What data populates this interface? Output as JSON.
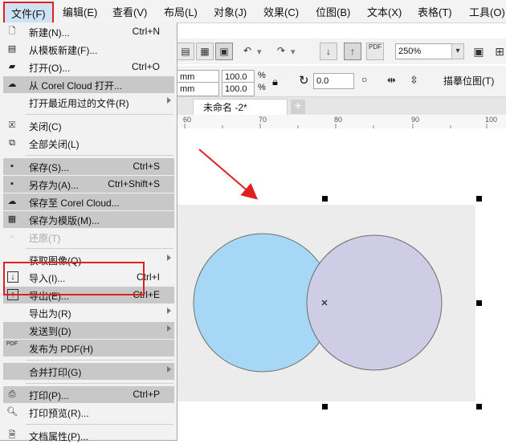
{
  "menubar": {
    "items": [
      {
        "id": "file",
        "label": "文件(F)"
      },
      {
        "id": "edit",
        "label": "编辑(E)"
      },
      {
        "id": "view",
        "label": "查看(V)"
      },
      {
        "id": "layout",
        "label": "布局(L)"
      },
      {
        "id": "object",
        "label": "对象(J)"
      },
      {
        "id": "effects",
        "label": "效果(C)"
      },
      {
        "id": "bitmap",
        "label": "位图(B)"
      },
      {
        "id": "text",
        "label": "文本(X)"
      },
      {
        "id": "table",
        "label": "表格(T)"
      },
      {
        "id": "tools",
        "label": "工具(O)"
      }
    ]
  },
  "file_menu": {
    "items": [
      {
        "label": "新建(N)...",
        "shortcut": "Ctrl+N",
        "icon": "new-document-icon"
      },
      {
        "label": "从模板新建(F)...",
        "shortcut": "",
        "icon": "new-from-template-icon"
      },
      {
        "label": "打开(O)...",
        "shortcut": "Ctrl+O",
        "icon": "open-folder-icon"
      },
      {
        "label": "从 Corel Cloud 打开...",
        "shortcut": "",
        "icon": "cloud-download-icon"
      },
      {
        "label": "打开最近用过的文件(R)",
        "shortcut": "",
        "icon": ""
      },
      {
        "label": "关闭(C)",
        "shortcut": "",
        "icon": "close-document-icon"
      },
      {
        "label": "全部关闭(L)",
        "shortcut": "",
        "icon": "close-all-icon"
      },
      {
        "label": "保存(S)...",
        "shortcut": "Ctrl+S",
        "icon": "save-icon"
      },
      {
        "label": "另存为(A)...",
        "shortcut": "Ctrl+Shift+S",
        "icon": "save-as-icon"
      },
      {
        "label": "保存至 Corel Cloud...",
        "shortcut": "",
        "icon": "cloud-upload-icon"
      },
      {
        "label": "保存为模版(M)...",
        "shortcut": "",
        "icon": "save-template-icon"
      },
      {
        "label": "还原(T)",
        "shortcut": "",
        "icon": "revert-icon"
      },
      {
        "label": "获取图像(Q)",
        "shortcut": "",
        "icon": ""
      },
      {
        "label": "导入(I)...",
        "shortcut": "Ctrl+I",
        "icon": "import-icon"
      },
      {
        "label": "导出(E)...",
        "shortcut": "Ctrl+E",
        "icon": "export-icon"
      },
      {
        "label": "导出为(R)",
        "shortcut": "",
        "icon": ""
      },
      {
        "label": "发送到(D)",
        "shortcut": "",
        "icon": ""
      },
      {
        "label": "发布为 PDF(H)",
        "shortcut": "",
        "icon": "pdf-icon"
      },
      {
        "label": "合并打印(G)",
        "shortcut": "",
        "icon": ""
      },
      {
        "label": "打印(P)...",
        "shortcut": "Ctrl+P",
        "icon": "print-icon"
      },
      {
        "label": "打印预览(R)...",
        "shortcut": "",
        "icon": "print-preview-icon"
      },
      {
        "label": "文档属性(P)...",
        "shortcut": "",
        "icon": "document-properties-icon"
      }
    ]
  },
  "toolbar": {
    "zoom_value": "250%",
    "pdf_label": "PDF",
    "unit1": "mm",
    "unit2": "mm",
    "scale_x": "100.0",
    "scale_y": "100.0",
    "percent1": "%",
    "percent2": "%",
    "rotation": "0.0",
    "trace_bitmap": "描摹位图(T)"
  },
  "document": {
    "tab_title": "未命名 -2*",
    "ruler_labels": [
      "60",
      "70",
      "80",
      "90",
      "100"
    ]
  },
  "colors": {
    "circle_left": "#a6d8f5",
    "circle_right": "#cfcde5",
    "annotation_red": "#e02020"
  }
}
